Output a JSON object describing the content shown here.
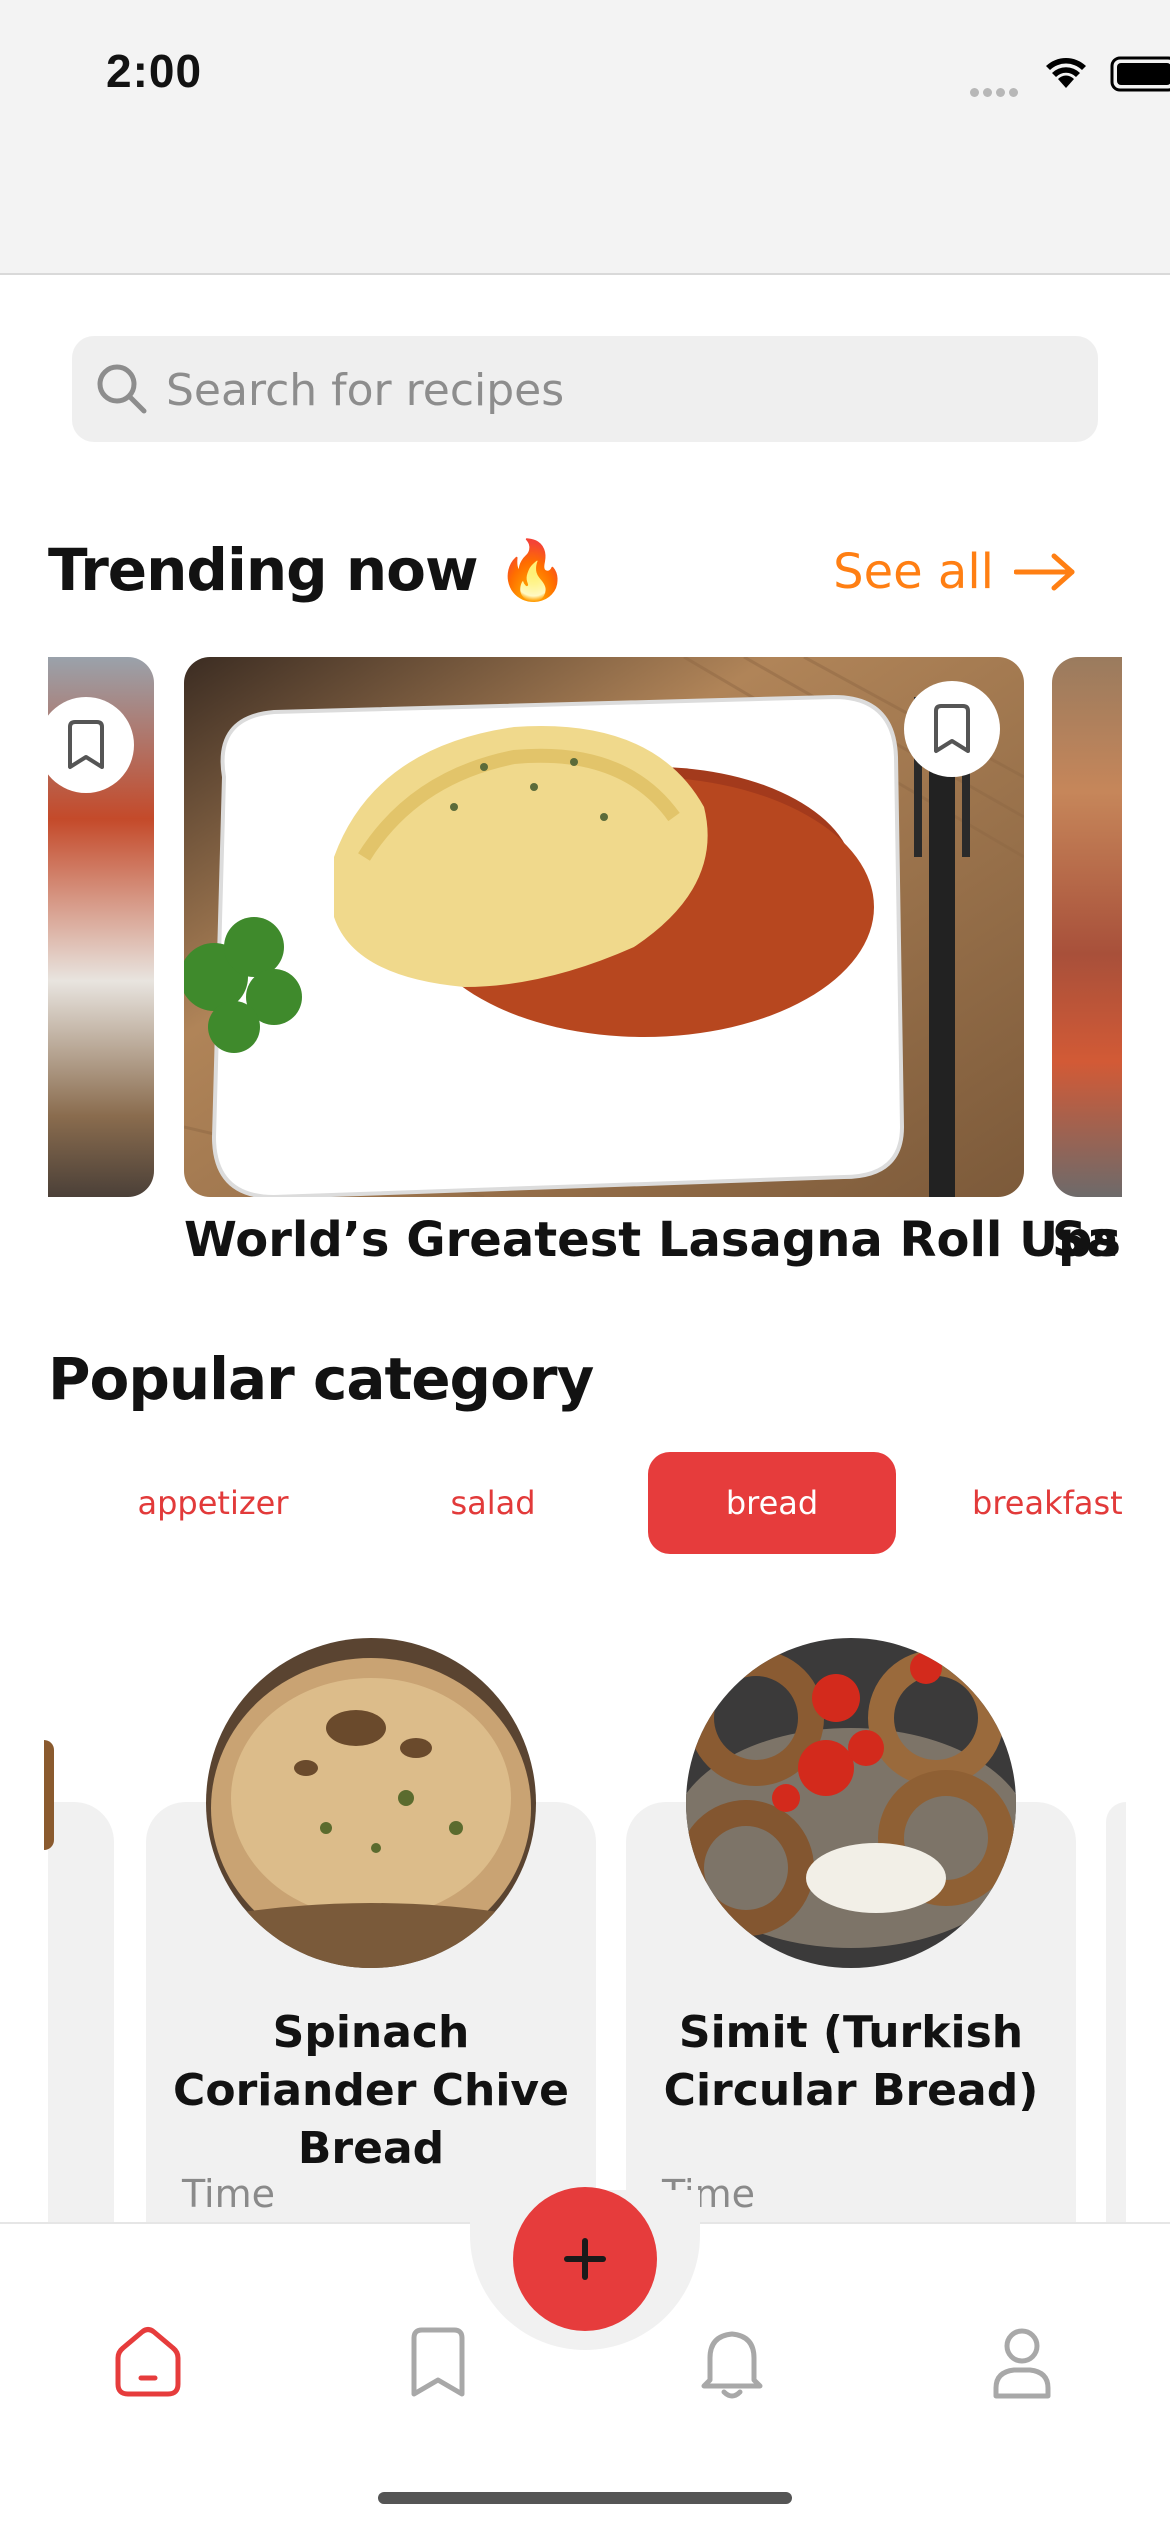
{
  "status_bar": {
    "time": "2:00"
  },
  "search": {
    "placeholder": "Search for recipes"
  },
  "trending": {
    "title": "Trending now 🔥",
    "see_all": "See all",
    "items": [
      {
        "caption": "World’s Greatest Lasagna Roll Ups"
      },
      {
        "caption": "Sau"
      }
    ]
  },
  "popular": {
    "title": "Popular category",
    "chips": [
      "appetizer",
      "salad",
      "bread",
      "breakfast"
    ],
    "active_chip": "bread",
    "recipes": [
      {
        "title": "Spinach Coriander Chive Bread",
        "time_label": "Time"
      },
      {
        "title": "Simit (Turkish Circular Bread)",
        "time_label": "Time"
      }
    ]
  },
  "tabbar": {
    "icons": [
      "home-icon",
      "bookmark-icon",
      "bell-icon",
      "profile-icon"
    ],
    "fab_icon": "plus-icon",
    "accent": "#e63c3c"
  },
  "colors": {
    "accent_orange": "#ff7f13",
    "accent_red": "#e63c3c"
  }
}
